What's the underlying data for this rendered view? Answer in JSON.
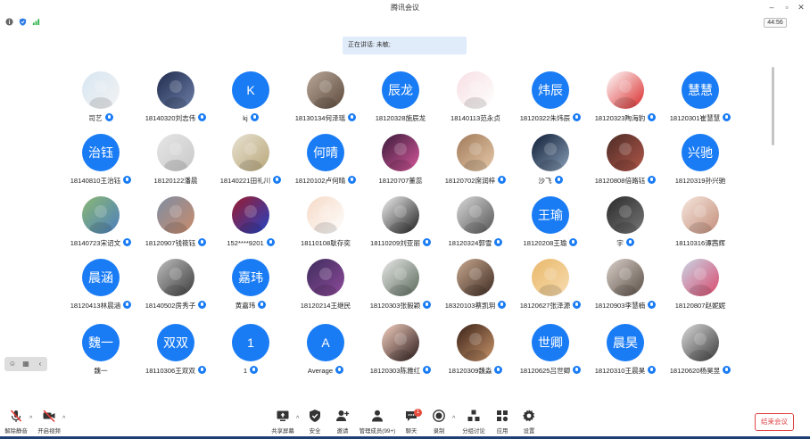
{
  "window": {
    "title": "腾讯会议",
    "timer": "44:56"
  },
  "speaking_label": "正在讲话: 未敏;",
  "participants": [
    {
      "name": "司艺",
      "avatar": {
        "kind": "photo",
        "colors": [
          "#d7e6f2",
          "#f3f3f3"
        ]
      },
      "mic": true
    },
    {
      "name": "18140320刘志伟",
      "avatar": {
        "kind": "photo",
        "colors": [
          "#1f2b4d",
          "#6d7fa8"
        ]
      },
      "mic": true
    },
    {
      "name": "kj",
      "avatar": {
        "kind": "text",
        "text": "K"
      },
      "mic": true
    },
    {
      "name": "18130134何泽瑶",
      "avatar": {
        "kind": "photo",
        "colors": [
          "#b9a89a",
          "#5d4a3c"
        ]
      },
      "mic": true
    },
    {
      "name": "18120328施辰龙",
      "avatar": {
        "kind": "text",
        "text": "辰龙"
      },
      "mic": false
    },
    {
      "name": "18140113范永贞",
      "avatar": {
        "kind": "photo",
        "colors": [
          "#f7dfe3",
          "#ffffff"
        ]
      },
      "mic": false
    },
    {
      "name": "18120322朱炜辰",
      "avatar": {
        "kind": "text",
        "text": "炜辰"
      },
      "mic": true
    },
    {
      "name": "18120323陶海豹",
      "avatar": {
        "kind": "photo",
        "colors": [
          "#ffffff",
          "#d92a2a"
        ]
      },
      "mic": true
    },
    {
      "name": "18120301崔慧慧",
      "avatar": {
        "kind": "text",
        "text": "慧慧"
      },
      "mic": true
    },
    {
      "name": "18140810王治钰",
      "avatar": {
        "kind": "text",
        "text": "治钰"
      },
      "mic": true
    },
    {
      "name": "18120122潘晨",
      "avatar": {
        "kind": "photo",
        "colors": [
          "#e6e6e6",
          "#c9c9c9"
        ]
      },
      "mic": false
    },
    {
      "name": "18140221田礼川",
      "avatar": {
        "kind": "photo",
        "colors": [
          "#e8e2d2",
          "#b9a77a"
        ]
      },
      "mic": true
    },
    {
      "name": "18120102卢何晴",
      "avatar": {
        "kind": "text",
        "text": "何晴"
      },
      "mic": true
    },
    {
      "name": "18120707董蕊",
      "avatar": {
        "kind": "photo",
        "colors": [
          "#3a1b3b",
          "#d6589b"
        ]
      },
      "mic": false
    },
    {
      "name": "18120702席润梓",
      "avatar": {
        "kind": "photo",
        "colors": [
          "#a07a5a",
          "#e6c9a9"
        ]
      },
      "mic": true
    },
    {
      "name": "沙飞",
      "avatar": {
        "kind": "photo",
        "colors": [
          "#0e1c35",
          "#8a9fb8"
        ]
      },
      "mic": true
    },
    {
      "name": "18120808倍路钰",
      "avatar": {
        "kind": "photo",
        "colors": [
          "#4a2b25",
          "#b2574a"
        ]
      },
      "mic": true
    },
    {
      "name": "18120319孙兴驰",
      "avatar": {
        "kind": "text",
        "text": "兴驰"
      },
      "mic": false
    },
    {
      "name": "18140723宋诏文",
      "avatar": {
        "kind": "photo",
        "colors": [
          "#8bb873",
          "#4c7fbf"
        ]
      },
      "mic": true
    },
    {
      "name": "18120907钱筱钰",
      "avatar": {
        "kind": "photo",
        "colors": [
          "#7f8ea3",
          "#c98b6b"
        ]
      },
      "mic": true
    },
    {
      "name": "152****9201",
      "avatar": {
        "kind": "photo",
        "colors": [
          "#9b1b2e",
          "#2344c4"
        ]
      },
      "mic": true
    },
    {
      "name": "18110108耿存奕",
      "avatar": {
        "kind": "photo",
        "colors": [
          "#f5d9c6",
          "#ffffff"
        ]
      },
      "mic": false
    },
    {
      "name": "18110209刘亚丽",
      "avatar": {
        "kind": "photo",
        "colors": [
          "#f0f0f0",
          "#202020"
        ]
      },
      "mic": true
    },
    {
      "name": "18120324郭雪",
      "avatar": {
        "kind": "photo",
        "colors": [
          "#d8d8d8",
          "#555555"
        ]
      },
      "mic": true
    },
    {
      "name": "18120208王瑜",
      "avatar": {
        "kind": "text",
        "text": "王瑜"
      },
      "mic": true
    },
    {
      "name": "宇",
      "avatar": {
        "kind": "photo",
        "colors": [
          "#2a2a2a",
          "#777777"
        ]
      },
      "mic": true
    },
    {
      "name": "18110316谭茜辉",
      "avatar": {
        "kind": "photo",
        "colors": [
          "#f6e6de",
          "#c38d79"
        ]
      },
      "mic": false
    },
    {
      "name": "18120413林晨涵",
      "avatar": {
        "kind": "text",
        "text": "晨涵"
      },
      "mic": true
    },
    {
      "name": "18140502房秀子",
      "avatar": {
        "kind": "photo",
        "colors": [
          "#bdbdbd",
          "#3d3d3d"
        ]
      },
      "mic": true
    },
    {
      "name": "黄嘉玮",
      "avatar": {
        "kind": "text",
        "text": "嘉玮"
      },
      "mic": true
    },
    {
      "name": "18120214王继民",
      "avatar": {
        "kind": "photo",
        "colors": [
          "#3e2d5c",
          "#8d4a9a"
        ]
      },
      "mic": false
    },
    {
      "name": "18120303张毅颖",
      "avatar": {
        "kind": "photo",
        "colors": [
          "#e8e8e8",
          "#5a6a5a"
        ]
      },
      "mic": true
    },
    {
      "name": "18320103蔡凯玥",
      "avatar": {
        "kind": "photo",
        "colors": [
          "#c9a98f",
          "#3d2a22"
        ]
      },
      "mic": true
    },
    {
      "name": "18120627张泽源",
      "avatar": {
        "kind": "photo",
        "colors": [
          "#e9b86a",
          "#f7dcb0"
        ]
      },
      "mic": true
    },
    {
      "name": "18120903李慧楠",
      "avatar": {
        "kind": "photo",
        "colors": [
          "#d9d0c9",
          "#5a4e46"
        ]
      },
      "mic": true
    },
    {
      "name": "18120807赵妮妮",
      "avatar": {
        "kind": "photo",
        "colors": [
          "#c9d6e6",
          "#d94a6d"
        ]
      },
      "mic": false
    },
    {
      "name": "魏一",
      "avatar": {
        "kind": "text",
        "text": "魏一"
      },
      "mic": false
    },
    {
      "name": "18110306王双双",
      "avatar": {
        "kind": "text",
        "text": "双双"
      },
      "mic": true
    },
    {
      "name": "1",
      "avatar": {
        "kind": "text",
        "text": "1"
      },
      "mic": true
    },
    {
      "name": "Average",
      "avatar": {
        "kind": "text",
        "text": "A"
      },
      "mic": true
    },
    {
      "name": "18120303陈雅红",
      "avatar": {
        "kind": "photo",
        "colors": [
          "#f6d1c1",
          "#2a1a1a"
        ]
      },
      "mic": true
    },
    {
      "name": "18120309魏淼",
      "avatar": {
        "kind": "photo",
        "colors": [
          "#3a2218",
          "#c9956b"
        ]
      },
      "mic": true
    },
    {
      "name": "18120625吕世卿",
      "avatar": {
        "kind": "text",
        "text": "世卿"
      },
      "mic": true
    },
    {
      "name": "18120310王晨昊",
      "avatar": {
        "kind": "text",
        "text": "晨昊"
      },
      "mic": true
    },
    {
      "name": "18120620杨昊昱",
      "avatar": {
        "kind": "photo",
        "colors": [
          "#d9d9d9",
          "#3b3b3b"
        ]
      },
      "mic": true
    }
  ],
  "toolbar": {
    "mute": "解除静音",
    "video": "开启视频",
    "share": "共享屏幕",
    "security": "安全",
    "invite": "邀请",
    "manage": "管理成员(99+)",
    "chat": "聊天",
    "chat_badge": "1",
    "record": "录制",
    "breakout": "分组讨论",
    "apps": "应用",
    "settings": "设置",
    "end": "结束会议"
  },
  "icons": {
    "info": "info-icon",
    "shield": "shield-icon",
    "signal": "signal-icon"
  },
  "colors": {
    "accent": "#1a7cf5",
    "end": "#e04444"
  }
}
